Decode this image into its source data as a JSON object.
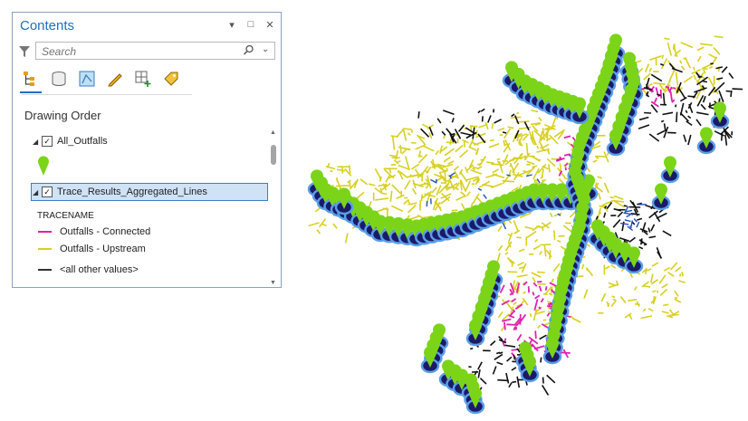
{
  "pane": {
    "title": "Contents",
    "search_placeholder": "Search",
    "section_title": "Drawing Order",
    "layers": [
      {
        "name": "All_Outfalls",
        "checked": true
      },
      {
        "name": "Trace_Results_Aggregated_Lines",
        "checked": true
      }
    ],
    "legend": {
      "heading": "TRACENAME",
      "items": [
        {
          "label": "Outfalls - Connected",
          "color": "#e020b0"
        },
        {
          "label": "Outfalls - Upstream",
          "color": "#d8d020"
        },
        {
          "label": "<all other values>",
          "color": "#333333"
        }
      ]
    },
    "toolbar_icons": [
      "list-by-drawing-order-icon",
      "list-by-data-source-icon",
      "list-by-selection-icon",
      "list-by-editing-icon",
      "list-by-snapping-icon",
      "list-by-labeling-icon"
    ]
  },
  "colors": {
    "accent": "#1f6fc2",
    "outfall_marker": "#7cd418",
    "outfall_ring": "#2f6fd0",
    "trace_connected": "#e020b0",
    "trace_upstream": "#d8d020",
    "other_lines": "#111111"
  }
}
